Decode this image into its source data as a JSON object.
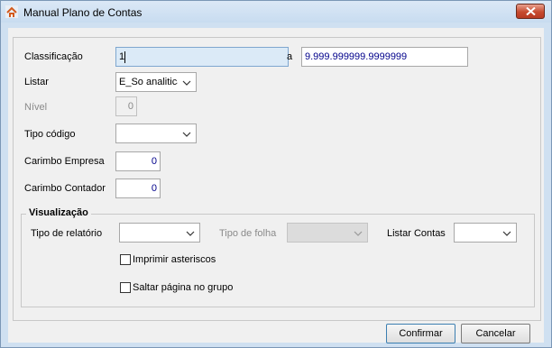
{
  "window": {
    "title": "Manual Plano de Contas"
  },
  "form": {
    "classificacao": {
      "label": "Classificação",
      "value_from": "1",
      "separator": "a",
      "value_to": "9.999.999999.9999999"
    },
    "listar": {
      "label": "Listar",
      "value": "E_So analiticas"
    },
    "nivel": {
      "label": "Nível",
      "value": "0"
    },
    "tipo_codigo": {
      "label": "Tipo código",
      "value": ""
    },
    "carimbo_empresa": {
      "label": "Carimbo Empresa",
      "value": "0"
    },
    "carimbo_contador": {
      "label": "Carimbo Contador",
      "value": "0"
    }
  },
  "visualizacao": {
    "title": "Visualização",
    "tipo_relatorio": {
      "label": "Tipo de relatório",
      "value": ""
    },
    "tipo_folha": {
      "label": "Tipo de folha",
      "value": ""
    },
    "listar_contas": {
      "label": "Listar Contas",
      "value": ""
    },
    "imprimir_asteriscos": {
      "label": "Imprimir asteriscos",
      "checked": false
    },
    "saltar_pagina": {
      "label": "Saltar página no grupo",
      "checked": false
    }
  },
  "buttons": {
    "confirmar": "Confirmar",
    "cancelar": "Cancelar"
  },
  "colors": {
    "title_bar": "#c8dcf0",
    "close_button": "#c64a2f",
    "numeric_text": "#00008b",
    "focused_field": "#dbeaf7"
  },
  "icons": {
    "app": "home-icon",
    "close": "close-icon",
    "dropdown": "chevron-down-icon"
  }
}
